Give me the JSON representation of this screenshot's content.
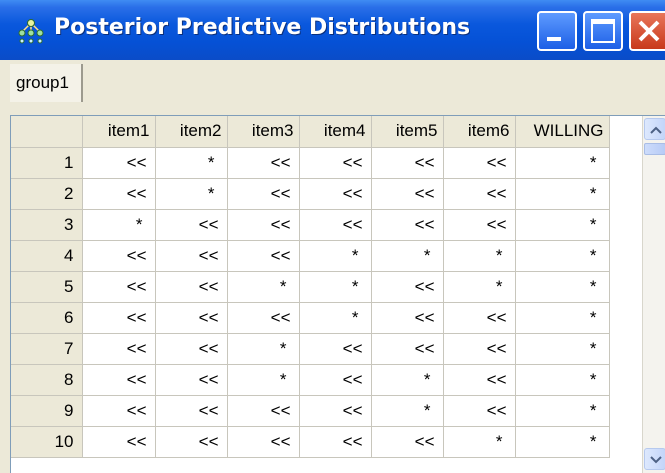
{
  "window": {
    "title": "Posterior Predictive Distributions"
  },
  "icons": {
    "app": "network-tree-icon",
    "minimize": "minimize-icon",
    "maximize": "maximize-icon",
    "close": "close-icon",
    "scroll_up": "chevron-up-icon",
    "scroll_down": "chevron-down-icon"
  },
  "tabs": [
    {
      "label": "group1",
      "selected": true
    }
  ],
  "grid": {
    "columns": [
      "item1",
      "item2",
      "item3",
      "item4",
      "item5",
      "item6",
      "WILLING"
    ],
    "rows": [
      {
        "label": "1",
        "cells": [
          "<<",
          "*",
          "<<",
          "<<",
          "<<",
          "<<",
          "*"
        ]
      },
      {
        "label": "2",
        "cells": [
          "<<",
          "*",
          "<<",
          "<<",
          "<<",
          "<<",
          "*"
        ]
      },
      {
        "label": "3",
        "cells": [
          "*",
          "<<",
          "<<",
          "<<",
          "<<",
          "<<",
          "*"
        ]
      },
      {
        "label": "4",
        "cells": [
          "<<",
          "<<",
          "<<",
          "*",
          "*",
          "*",
          "*"
        ]
      },
      {
        "label": "5",
        "cells": [
          "<<",
          "<<",
          "*",
          "*",
          "<<",
          "*",
          "*"
        ]
      },
      {
        "label": "6",
        "cells": [
          "<<",
          "<<",
          "<<",
          "*",
          "<<",
          "<<",
          "*"
        ]
      },
      {
        "label": "7",
        "cells": [
          "<<",
          "<<",
          "*",
          "<<",
          "<<",
          "<<",
          "*"
        ]
      },
      {
        "label": "8",
        "cells": [
          "<<",
          "<<",
          "*",
          "<<",
          "*",
          "<<",
          "*"
        ]
      },
      {
        "label": "9",
        "cells": [
          "<<",
          "<<",
          "<<",
          "<<",
          "*",
          "<<",
          "*"
        ]
      },
      {
        "label": "10",
        "cells": [
          "<<",
          "<<",
          "<<",
          "<<",
          "<<",
          "*",
          "*"
        ]
      }
    ]
  },
  "colors": {
    "titlebar": "#0a58dd",
    "title_text": "#ffffff",
    "close_button": "#c8391b",
    "face": "#ece9d8"
  }
}
